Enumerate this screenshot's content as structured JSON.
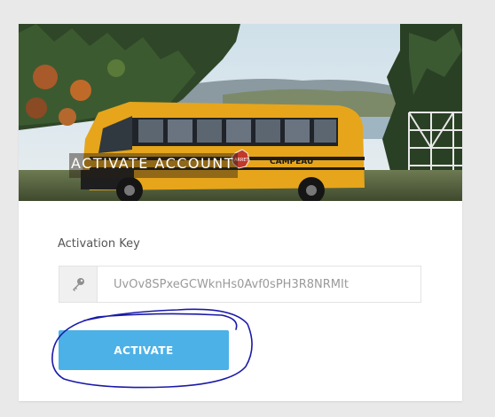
{
  "card": {
    "title": "ACTIVATE ACCOUNT",
    "bus_sign": "CAMPEAU",
    "stop_sign": "ARRET"
  },
  "form": {
    "label": "Activation Key",
    "key_value": "UvOv8SPxeGCWknHs0Avf0sPH3R8NRMIt",
    "key_icon": "key-icon",
    "button_label": "ACTIVATE"
  },
  "colors": {
    "page_bg": "#e9e9e9",
    "button": "#4cb1e6",
    "annotation": "#1a1aa8"
  }
}
